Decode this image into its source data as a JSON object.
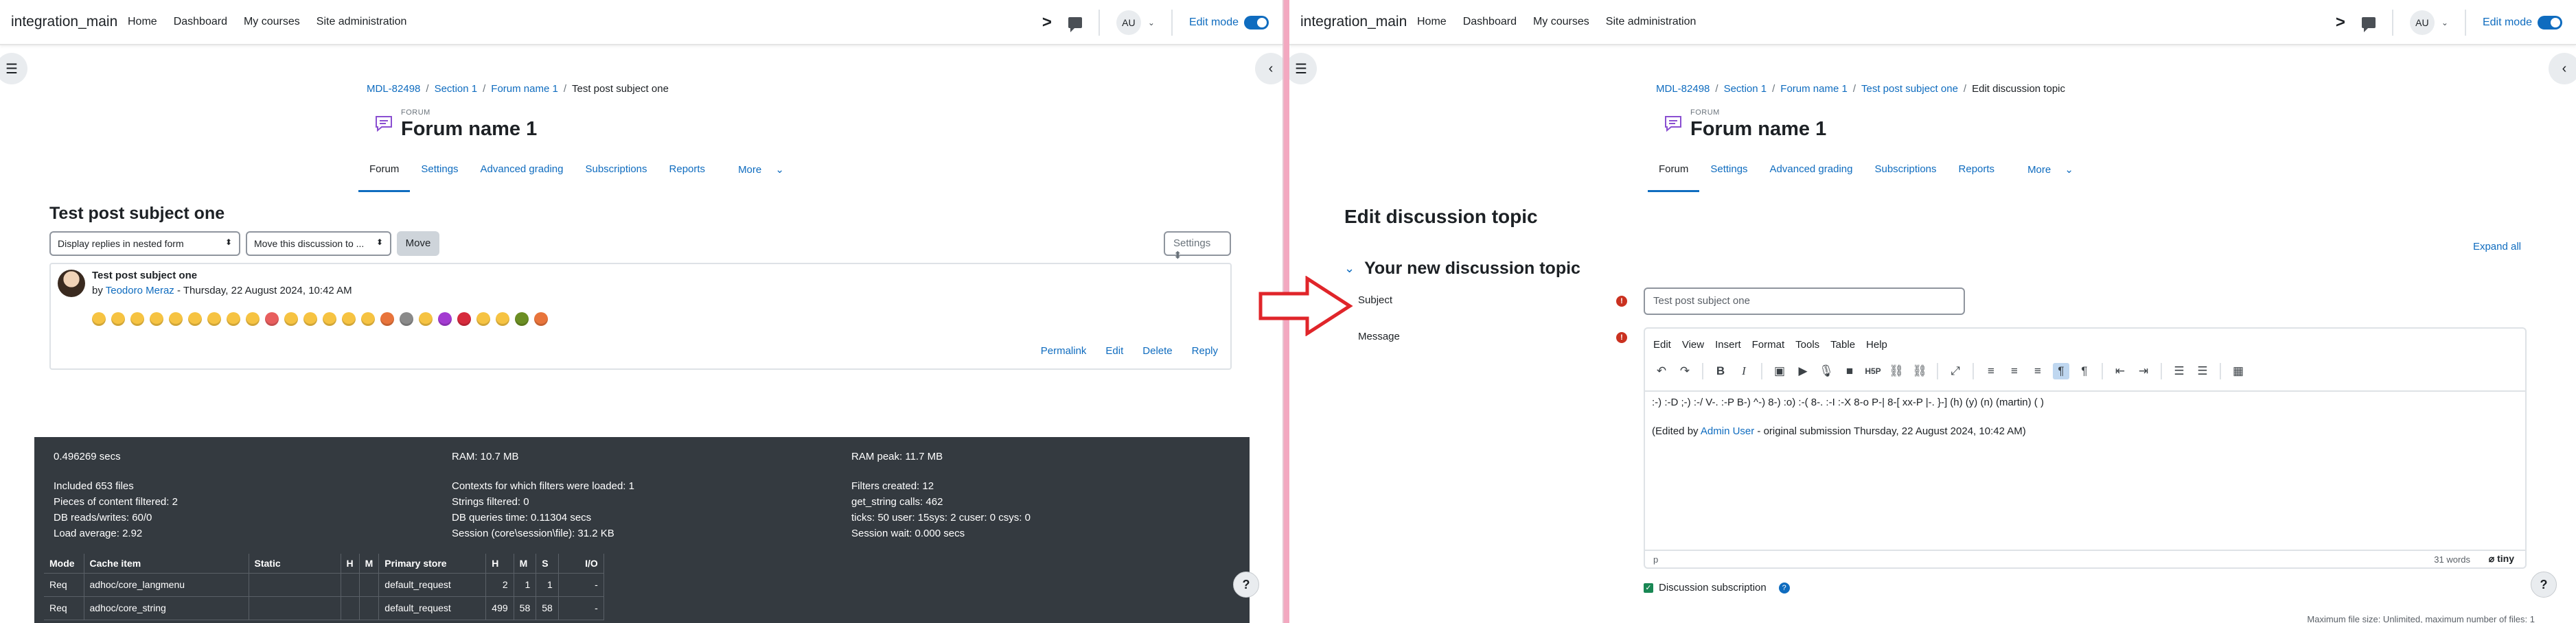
{
  "left": {
    "site_name": "integration_main",
    "nav": [
      "Home",
      "Dashboard",
      "My courses",
      "Site administration"
    ],
    "avatar_initials": "AU",
    "edit_mode_label": "Edit mode",
    "breadcrumb": [
      "MDL-82498",
      "Section 1",
      "Forum name 1",
      "Test post subject one"
    ],
    "forum_label": "FORUM",
    "forum_title": "Forum name 1",
    "tabs": [
      "Forum",
      "Settings",
      "Advanced grading",
      "Subscriptions",
      "Reports",
      "More"
    ],
    "discussion_title": "Test post subject one",
    "display_select": "Display replies in nested form",
    "move_select": "Move this discussion to ...",
    "move_button": "Move",
    "settings_button": "Settings",
    "post": {
      "subject": "Test post subject one",
      "by": "by",
      "author": "Teodoro Meraz",
      "date": "- Thursday, 22 August 2024, 10:42 AM",
      "actions": [
        "Permalink",
        "Edit",
        "Delete",
        "Reply"
      ]
    },
    "emoji_colors": [
      "#f6c342",
      "#f6c342",
      "#f6c342",
      "#f6c342",
      "#f6c342",
      "#f6c342",
      "#f6c342",
      "#f6c342",
      "#f6c342",
      "#e85e5e",
      "#f6c342",
      "#f6c342",
      "#f6c342",
      "#f6c342",
      "#f6c342",
      "#e8743b",
      "#8a8a8a",
      "#f6c342",
      "#a33bd1",
      "#d62a3c",
      "#f6c342",
      "#f6c342",
      "#6b8e23",
      "#e8743b"
    ],
    "perf": {
      "col1": [
        "0.496269 secs",
        "",
        "Included 653 files",
        "Pieces of content filtered: 2",
        "DB reads/writes: 60/0",
        "Load average: 2.92"
      ],
      "col2": [
        "RAM: 10.7 MB",
        "",
        "Contexts for which filters were loaded: 1",
        "Strings filtered: 0",
        "DB queries time: 0.11304 secs",
        "Session (core\\session\\file): 31.2 KB"
      ],
      "col3": [
        "RAM peak: 11.7 MB",
        "",
        "Filters created: 12",
        "get_string calls: 462",
        "ticks: 50 user: 15sys: 2 cuser: 0 csys: 0",
        "Session wait: 0.000 secs"
      ],
      "cache_headers": [
        "Mode",
        "Cache item",
        "Static",
        "H",
        "M",
        "Primary store",
        "H",
        "M",
        "S",
        "I/O"
      ],
      "cache_rows": [
        [
          "Req",
          "adhoc/core_langmenu",
          "",
          "",
          "",
          "default_request",
          "2",
          "1",
          "1",
          "-"
        ],
        [
          "Req",
          "adhoc/core_string",
          "",
          "",
          "",
          "default_request",
          "499",
          "58",
          "58",
          "-"
        ]
      ]
    },
    "help_label": "?"
  },
  "right": {
    "site_name": "integration_main",
    "nav": [
      "Home",
      "Dashboard",
      "My courses",
      "Site administration"
    ],
    "avatar_initials": "AU",
    "edit_mode_label": "Edit mode",
    "breadcrumb": [
      "MDL-82498",
      "Section 1",
      "Forum name 1",
      "Test post subject one",
      "Edit discussion topic"
    ],
    "forum_label": "FORUM",
    "forum_title": "Forum name 1",
    "tabs": [
      "Forum",
      "Settings",
      "Advanced grading",
      "Subscriptions",
      "Reports",
      "More"
    ],
    "page_title": "Edit discussion topic",
    "expand_all": "Expand all",
    "section_title": "Your new discussion topic",
    "subject_label": "Subject",
    "subject_value": "Test post subject one",
    "message_label": "Message",
    "editor_menu": [
      "Edit",
      "View",
      "Insert",
      "Format",
      "Tools",
      "Table",
      "Help"
    ],
    "editor_line1": ":-) :-D ;-) :-/ V-. :-P B-) ^-) 8-) :o) :-( 8-. :-I :-X 8-o P-| 8-[ xx-P |-. }-] (h) (y) (n) (martin) ( )",
    "editor_line2_prefix": "(Edited by",
    "editor_line2_link": "Admin User",
    "editor_line2_suffix": "- original submission Thursday, 22 August 2024, 10:42 AM)",
    "status_path": "p",
    "word_count": "31 words",
    "tiny_brand": "tiny",
    "subscription_label": "Discussion subscription",
    "max_file": "Maximum file size: Unlimited, maximum number of files: 1",
    "help_label": "?"
  },
  "colors": {
    "accent": "#0f6cbf",
    "dark_panel": "#343a40",
    "required": "#ca3120",
    "arrow": "#e0252a"
  }
}
